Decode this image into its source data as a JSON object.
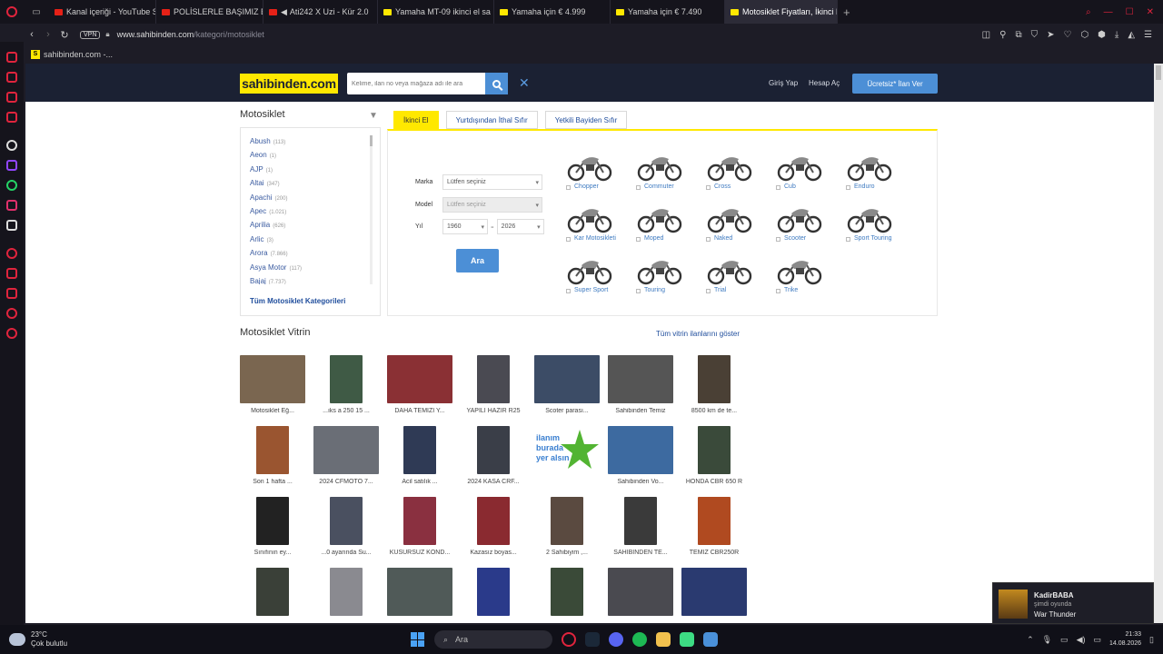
{
  "browser": {
    "tabs": [
      {
        "label": "Kanal içeriği - YouTube Stu",
        "color": "#e62117"
      },
      {
        "label": "POLİSLERLE BAŞIMIZ BELA",
        "color": "#e62117"
      },
      {
        "label": "Ati242 X Uzi - Kür 2.0",
        "color": "#e62117"
      },
      {
        "label": "Yamaha MT-09 ikinci el sa",
        "color": "#ffe800"
      },
      {
        "label": "Yamaha için € 4.999",
        "color": "#ffe800"
      },
      {
        "label": "Yamaha için € 7.490",
        "color": "#ffe800"
      },
      {
        "label": "Motosiklet Fiyatları, İkinci E",
        "color": "#e0243d"
      }
    ],
    "address": {
      "vpn": "VPN",
      "host": "www.sahibinden.com",
      "path": "/kategori/motosiklet"
    },
    "bookmark": {
      "icon_letter": "S",
      "label": "sahibinden.com -..."
    }
  },
  "header": {
    "logo": "sahibinden.com",
    "search_placeholder": "Kelime, ilan no veya mağaza adı ile ara",
    "login": "Giriş Yap",
    "register": "Hesap Aç",
    "cta": "Ücretsiz* İlan Ver"
  },
  "category": {
    "title": "Motosiklet",
    "brands": [
      {
        "name": "Abush",
        "count": "(113)"
      },
      {
        "name": "Aeon",
        "count": "(1)"
      },
      {
        "name": "AJP",
        "count": "(1)"
      },
      {
        "name": "Altai",
        "count": "(347)"
      },
      {
        "name": "Apachi",
        "count": "(200)"
      },
      {
        "name": "Apec",
        "count": "(1.021)"
      },
      {
        "name": "Aprilia",
        "count": "(626)"
      },
      {
        "name": "Arlic",
        "count": "(3)"
      },
      {
        "name": "Arora",
        "count": "(7.866)"
      },
      {
        "name": "Asya Motor",
        "count": "(117)"
      },
      {
        "name": "Bajaj",
        "count": "(7.737)"
      }
    ],
    "all_link": "Tüm Motosiklet Kategorileri"
  },
  "filters": {
    "tabs": [
      "İkinci El",
      "Yurtdışından İthal Sıfır",
      "Yetkili Bayiden Sıfır"
    ],
    "marka_label": "Marka",
    "model_label": "Model",
    "yil_label": "Yıl",
    "marka_value": "Lütfen seçiniz",
    "model_value": "Lütfen seçiniz",
    "year_from": "1960",
    "year_to": "2026",
    "search_button": "Ara",
    "types": [
      "Chopper",
      "Commuter",
      "Cross",
      "Cub",
      "Enduro",
      "Kar Motosikleti",
      "Moped",
      "Naked",
      "Scooter",
      "Sport Touring",
      "Super Sport",
      "Touring",
      "Trial",
      "Trike"
    ]
  },
  "vitrin": {
    "title": "Motosiklet Vitrin",
    "link": "Tüm vitrin ilanlarını göster",
    "items": [
      {
        "caption": "Motosiklet Eğ...",
        "color": "#7a6650"
      },
      {
        "caption": "...ıks a 250 15 ...",
        "color": "#3f5a45"
      },
      {
        "caption": "DAHA TEMİZİ Y...",
        "color": "#8a3034"
      },
      {
        "caption": "YAPILI HAZIR R25",
        "color": "#4a4a52"
      },
      {
        "caption": "Scoter parası...",
        "color": "#3c4c66"
      },
      {
        "caption": "Sahibinden Temiz",
        "color": "#555555"
      },
      {
        "caption": "8500 km de te...",
        "color": "#4a4035"
      },
      {
        "caption": "Son 1 hafta ...",
        "color": "#9a5530"
      },
      {
        "caption": "2024 CFMOTO 7...",
        "color": "#6a6e76"
      },
      {
        "caption": "Acil satılık ...",
        "color": "#2f3a55"
      },
      {
        "caption": "2024 KASA CRF...",
        "color": "#3a3e48"
      },
      {
        "caption": "",
        "color": "#ffffff"
      },
      {
        "caption": "Sahibinden Vo...",
        "color": "#3d6aa0"
      },
      {
        "caption": "HONDA CBR 650 R",
        "color": "#3a4a3a"
      },
      {
        "caption": "Sınıfının ey...",
        "color": "#222222"
      },
      {
        "caption": "...0 ayarında Su...",
        "color": "#4a5060"
      },
      {
        "caption": "KUSURSUZ KOND...",
        "color": "#8a3040"
      },
      {
        "caption": "Kazasız boyas...",
        "color": "#8a2a30"
      },
      {
        "caption": "2 Sahibiyim ,...",
        "color": "#5a4a40"
      },
      {
        "caption": "SAHİBİNDEN TE...",
        "color": "#3a3a3a"
      },
      {
        "caption": "TEMİZ CBR250R",
        "color": "#b04a20"
      },
      {
        "caption": "",
        "color": "#3a4038"
      },
      {
        "caption": "",
        "color": "#8a8a90"
      },
      {
        "caption": "",
        "color": "#505a58"
      },
      {
        "caption": "",
        "color": "#2a3a8a"
      },
      {
        "caption": "",
        "color": "#3a4a38"
      },
      {
        "caption": "",
        "color": "#4a4a50"
      },
      {
        "caption": "",
        "color": "#2a3a70"
      }
    ],
    "ad_text_1": "ilanım",
    "ad_text_2": "burada",
    "ad_text_3": "yer alsın"
  },
  "taskbar": {
    "temp": "23°C",
    "weather": "Çok bulutlu",
    "search": "Ara",
    "time": "21:33",
    "date": "14.08.2026"
  },
  "notification": {
    "user": "KadirBABA",
    "status": "şimdi oyunda",
    "game": "War Thunder"
  }
}
